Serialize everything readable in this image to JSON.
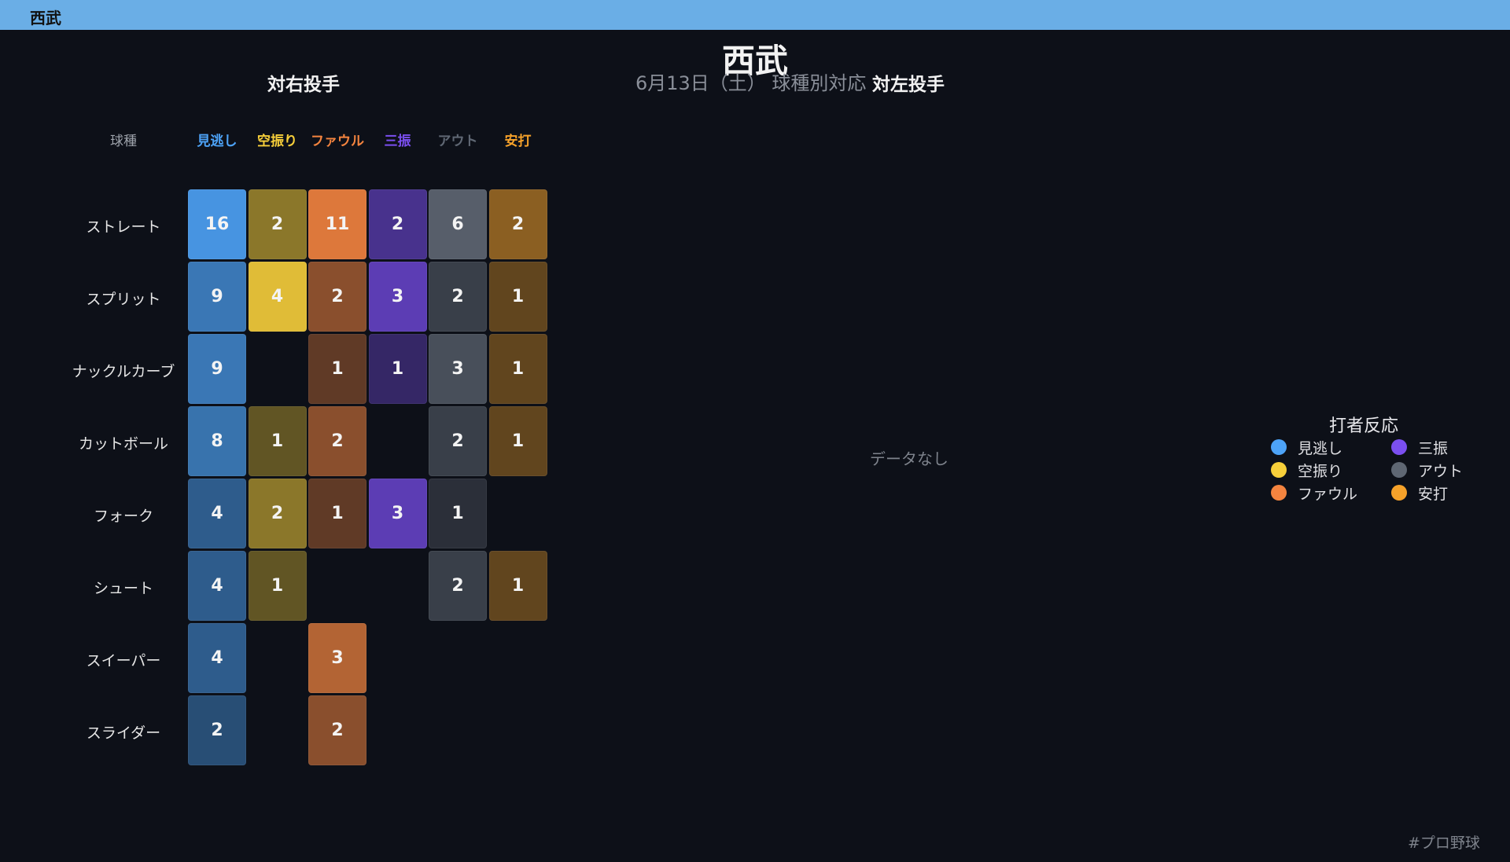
{
  "window": {
    "title": "西武"
  },
  "header": {
    "title": "西武",
    "subtitle": "6月13日（土） 球種別対応"
  },
  "panels": {
    "right_pitcher": {
      "title": "対右投手"
    },
    "left_pitcher": {
      "title": "対左投手",
      "empty_text": "データなし"
    }
  },
  "legend": {
    "title": "打者反応",
    "items": [
      {
        "label": "見逃し",
        "color": "#4da3f7"
      },
      {
        "label": "三振",
        "color": "#7b4ff0"
      },
      {
        "label": "空振り",
        "color": "#f7cf3a"
      },
      {
        "label": "アウト",
        "color": "#5f6773"
      },
      {
        "label": "ファウル",
        "color": "#f4843f"
      },
      {
        "label": "安打",
        "color": "#f6a22a"
      }
    ]
  },
  "footer": {
    "hashtag": "#プロ野球"
  },
  "chart_data": {
    "type": "heatmap",
    "title": "対右投手",
    "row_header": "球種",
    "columns": [
      {
        "label": "見逃し",
        "color": "#4da3f7"
      },
      {
        "label": "空振り",
        "color": "#f7cf3a"
      },
      {
        "label": "ファウル",
        "color": "#f4843f"
      },
      {
        "label": "三振",
        "color": "#7b4ff0"
      },
      {
        "label": "アウト",
        "color": "#5f6773"
      },
      {
        "label": "安打",
        "color": "#f6a22a"
      }
    ],
    "rows": [
      "ストレート",
      "スプリット",
      "ナックルカーブ",
      "カットボール",
      "フォーク",
      "シュート",
      "スイーパー",
      "スライダー"
    ],
    "values": [
      [
        16,
        2,
        11,
        2,
        6,
        2
      ],
      [
        9,
        4,
        2,
        3,
        2,
        1
      ],
      [
        9,
        null,
        1,
        1,
        3,
        1
      ],
      [
        8,
        1,
        2,
        null,
        2,
        1
      ],
      [
        4,
        2,
        1,
        3,
        1,
        null
      ],
      [
        4,
        1,
        null,
        null,
        2,
        1
      ],
      [
        4,
        null,
        3,
        null,
        null,
        null
      ],
      [
        2,
        null,
        2,
        null,
        null,
        null
      ]
    ]
  }
}
